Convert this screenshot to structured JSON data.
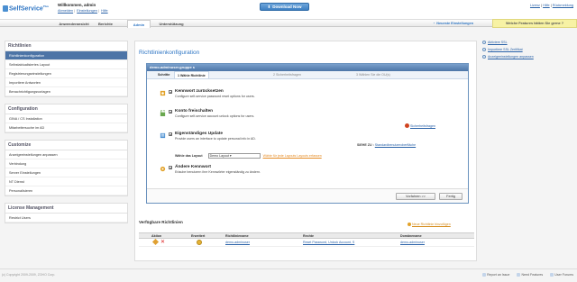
{
  "header": {
    "logo_text": "SelfService",
    "logo_tm": "Plus",
    "welcome": "Willkommen, admin",
    "links": [
      "Abmelden",
      "Einstellungen",
      "Hilfe"
    ],
    "download_label": "Download Now",
    "right_links": [
      "Lizenz",
      "Hilfe",
      "Rückmeldung"
    ]
  },
  "nav": {
    "tabs": [
      "Anwenderansicht",
      "Berichte",
      "Admin",
      "Unterstützung"
    ],
    "active_tab": "Admin",
    "recent_label": "Neueste Einstellungen",
    "features_label": "Welche Features hätten Sie gerne ?"
  },
  "sidebar": {
    "sections": [
      {
        "title": "Richtlinien",
        "items": [
          "Richtlinienkonfiguration",
          "Selbstaktualisiertes Layout",
          "Registrierungseinstellungen",
          "Importiere Antworten",
          "Benachrichtigungsvorlagen"
        ]
      },
      {
        "title": "Configuration",
        "items": [
          "GINA / CS Installation",
          "Mitarbeitersuche im AD"
        ]
      },
      {
        "title": "Customize",
        "items": [
          "Anzeigeeinstellungen anpassen",
          "Verbindung",
          "Server Einstellungen",
          "NT Dienst",
          "Personalisieren"
        ]
      },
      {
        "title": "License Management",
        "items": [
          "Restrict Users"
        ]
      }
    ],
    "active_item": "Richtlinienkonfiguration"
  },
  "main": {
    "title": "Richtlinienkonfiguration",
    "wizard": {
      "header": "demo-adminuser.gruppe s",
      "steps": [
        "Schritte",
        "1  Wähle Richtlinie",
        "2   Sicherheitsfragen",
        "3   Wählen Sie die OU(s)"
      ],
      "options": [
        {
          "title": "Kennwort zurücksetzen",
          "desc": "Configure self-service password reset options for users.",
          "checked": "✔"
        },
        {
          "title": "Konto freischalten",
          "desc": "Configure self-service account unlock options for users.",
          "checked": "✔"
        },
        {
          "title": "Eigenständiges Update",
          "desc": "Provide users an interface to update personal info in AD.",
          "checked": "✔"
        },
        {
          "title": "Ändere Kennwort",
          "desc": "Erlaube benutzern ihre Kennwörter eigenständig zu ändern.",
          "checked": "✔"
        }
      ],
      "security_link": "Sicherheitsfragen",
      "std_prefix": "SIEHE ZU :",
      "std_link": "Standardbenutzeroberfläche",
      "layout_label": "Wähle das Layout",
      "layout_value": "Demo Layout",
      "layout_link": "Wähle für jede Layouts Layouts erfassen",
      "next_label": "Vorfahren >>",
      "finish_label": "Fertig"
    },
    "available": {
      "title": "Verfügbare Richtlinien",
      "add_link": "Neue Richtlinie hinzufügen",
      "columns": [
        "Aktion",
        "Erweitert",
        "Richtliniename",
        "Rechte",
        "Domänename"
      ],
      "rows": [
        {
          "name": "demo-adminuser",
          "rights": "Reset Password, Unlock Account, S",
          "domain": "demo-adminuser"
        }
      ]
    }
  },
  "right_panel": {
    "items": [
      "Aktiviere SSL",
      "Importiere SSL Zertifikat",
      "Anzeigeeinstellungen anpassen"
    ]
  },
  "footer": {
    "copyright": "(c) Copyright 2009-2009, ZOHO Corp.",
    "links": [
      "Report an Issue",
      "Need Features",
      "User Forums"
    ]
  }
}
